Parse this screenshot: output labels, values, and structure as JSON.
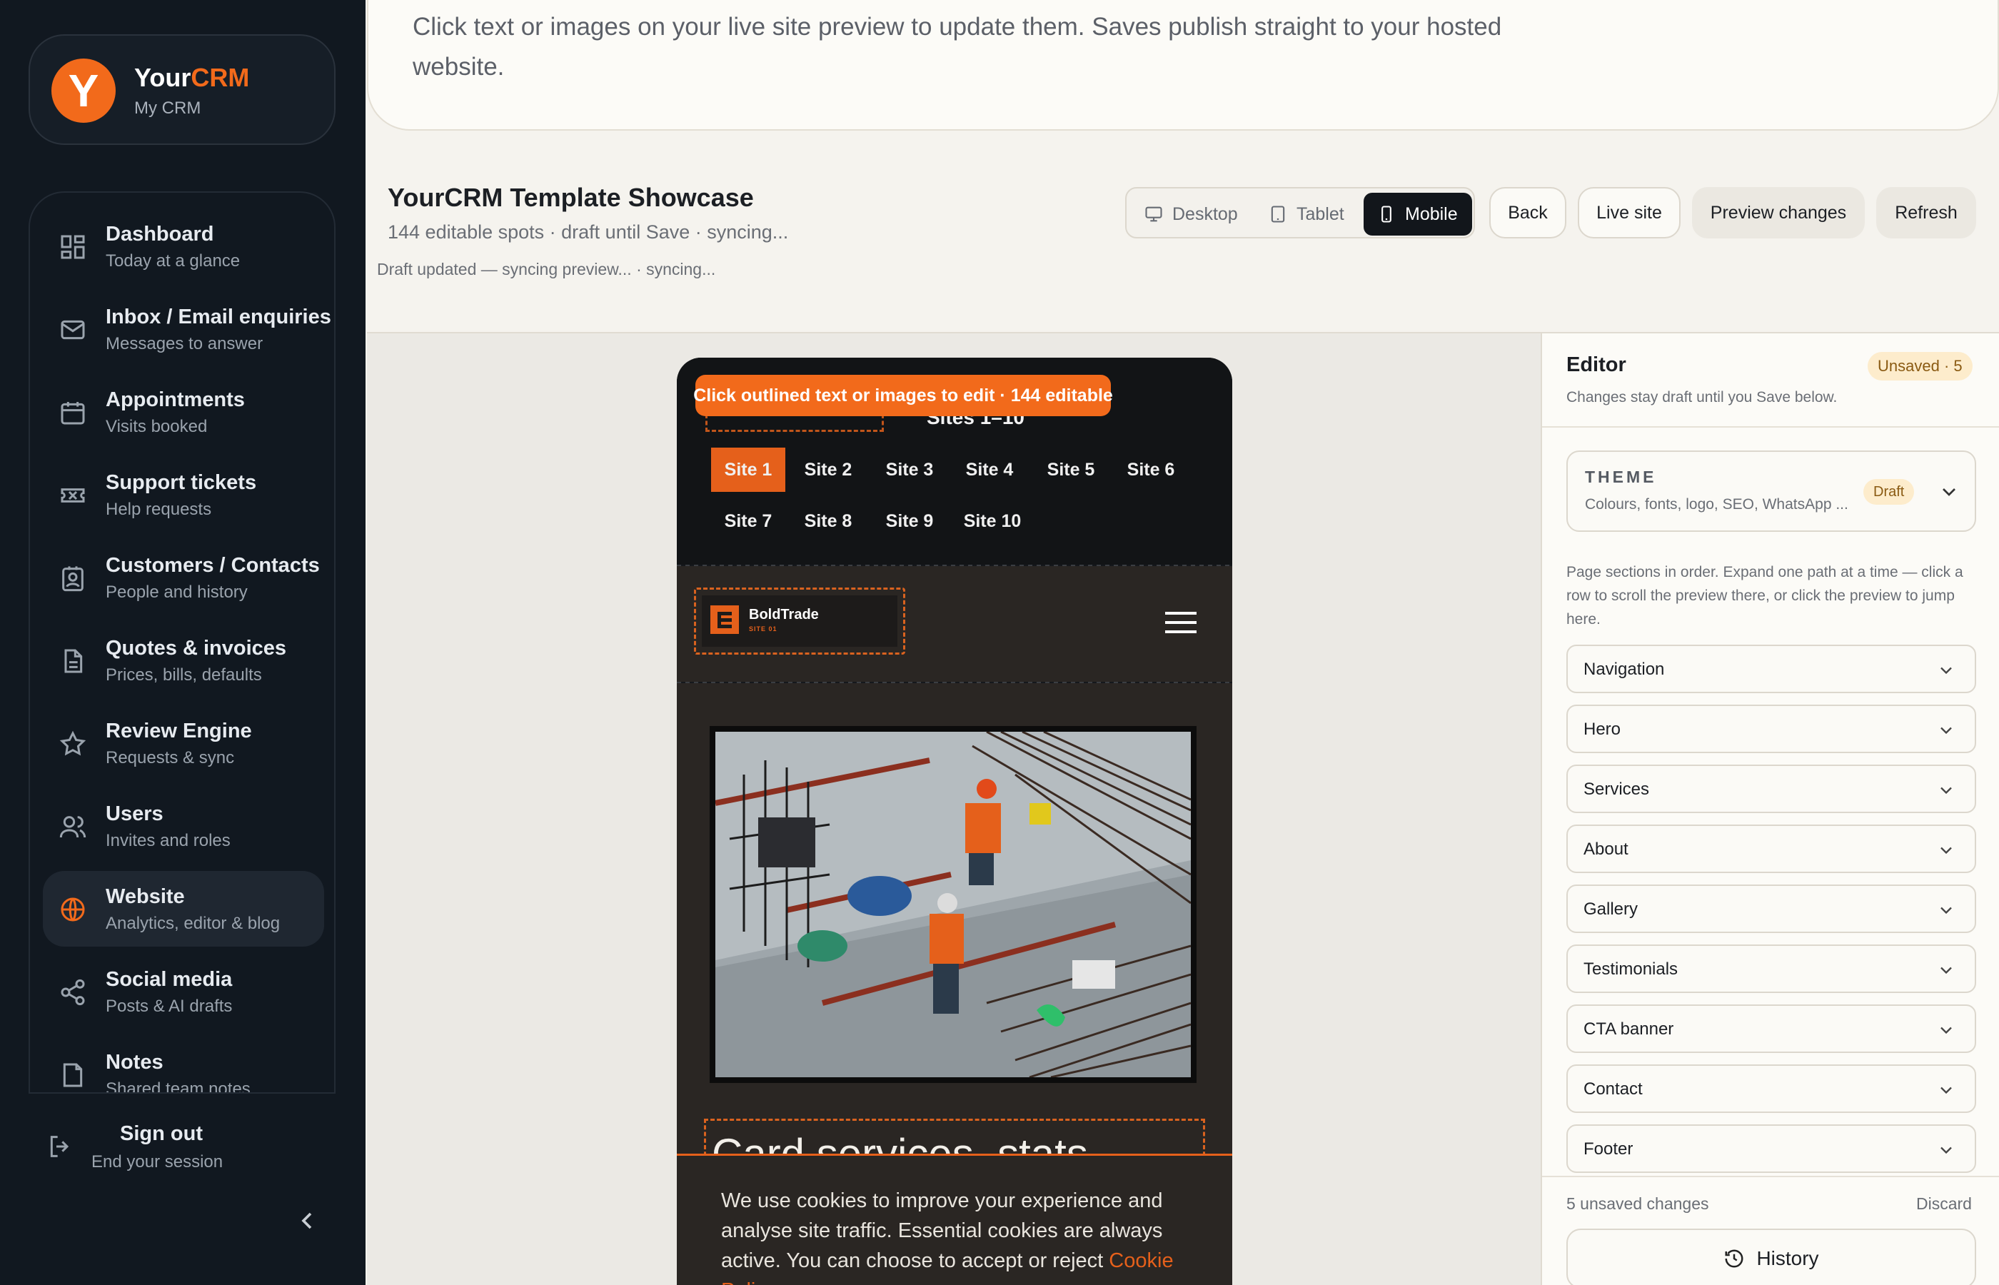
{
  "brand": {
    "name_main": "Your",
    "name_accent": "CRM",
    "subtitle": "My CRM",
    "logo_letter": "Y",
    "accent_color": "#f26a1b"
  },
  "sidebar": {
    "items": [
      {
        "title": "Dashboard",
        "subtitle": "Today at a glance",
        "icon": "grid-icon"
      },
      {
        "title": "Inbox / Email enquiries",
        "subtitle": "Messages to answer",
        "icon": "mail-icon"
      },
      {
        "title": "Appointments",
        "subtitle": "Visits booked",
        "icon": "calendar-icon"
      },
      {
        "title": "Support tickets",
        "subtitle": "Help requests",
        "icon": "ticket-icon"
      },
      {
        "title": "Customers / Contacts",
        "subtitle": "People and history",
        "icon": "contact-icon"
      },
      {
        "title": "Quotes & invoices",
        "subtitle": "Prices, bills, defaults",
        "icon": "document-icon"
      },
      {
        "title": "Review Engine",
        "subtitle": "Requests & sync",
        "icon": "star-icon"
      },
      {
        "title": "Users",
        "subtitle": "Invites and roles",
        "icon": "users-icon"
      },
      {
        "title": "Website",
        "subtitle": "Analytics, editor & blog",
        "icon": "globe-icon",
        "active": true
      },
      {
        "title": "Social media",
        "subtitle": "Posts & AI drafts",
        "icon": "share-icon"
      },
      {
        "title": "Notes",
        "subtitle": "Shared team notes",
        "icon": "note-icon"
      }
    ],
    "signout": {
      "title": "Sign out",
      "subtitle": "End your session"
    }
  },
  "topcard": {
    "text": "Click text or images on your live site preview to update them. Saves publish straight to your hosted website."
  },
  "header": {
    "title": "YourCRM Template Showcase",
    "subtitle": "144 editable spots · draft until Save · syncing...",
    "status": "Draft updated — syncing preview... · syncing...",
    "views": [
      "Desktop",
      "Tablet",
      "Mobile"
    ],
    "active_view": "Mobile",
    "buttons": {
      "back": "Back",
      "live": "Live site",
      "preview": "Preview changes",
      "refresh": "Refresh"
    }
  },
  "preview": {
    "banner": "Click outlined text or images to edit · 144 editable",
    "sites_label": "Sites 1–10",
    "sites": [
      "Site 1",
      "Site 2",
      "Site 3",
      "Site 4",
      "Site 5",
      "Site 6",
      "Site 7",
      "Site 8",
      "Site 9",
      "Site 10"
    ],
    "active_site": "Site 1",
    "logo_name": "BoldTrade",
    "logo_sub": "SITE 01",
    "heading": "Card services, stats",
    "cookie_text": "We use cookies to improve your experience and analyse site traffic. Essential cookies are always active. You can choose to accept or reject",
    "cookie_link": "Cookie Policy",
    "colors": {
      "orange": "#e5601b",
      "dark": "#2a2623"
    }
  },
  "editor": {
    "title": "Editor",
    "badge": "Unsaved · 5",
    "subtitle": "Changes stay draft until you Save below.",
    "theme": {
      "label": "THEME",
      "subtitle": "Colours, fonts, logo, SEO, WhatsApp ...",
      "badge": "Draft"
    },
    "help": "Page sections in order. Expand one path at a time — click a row to scroll the preview there, or click the preview to jump here.",
    "sections": [
      "Navigation",
      "Hero",
      "Services",
      "About",
      "Gallery",
      "Testimonials",
      "CTA banner",
      "Contact",
      "Footer"
    ],
    "unsaved": "5 unsaved changes",
    "discard": "Discard",
    "history": "History"
  }
}
